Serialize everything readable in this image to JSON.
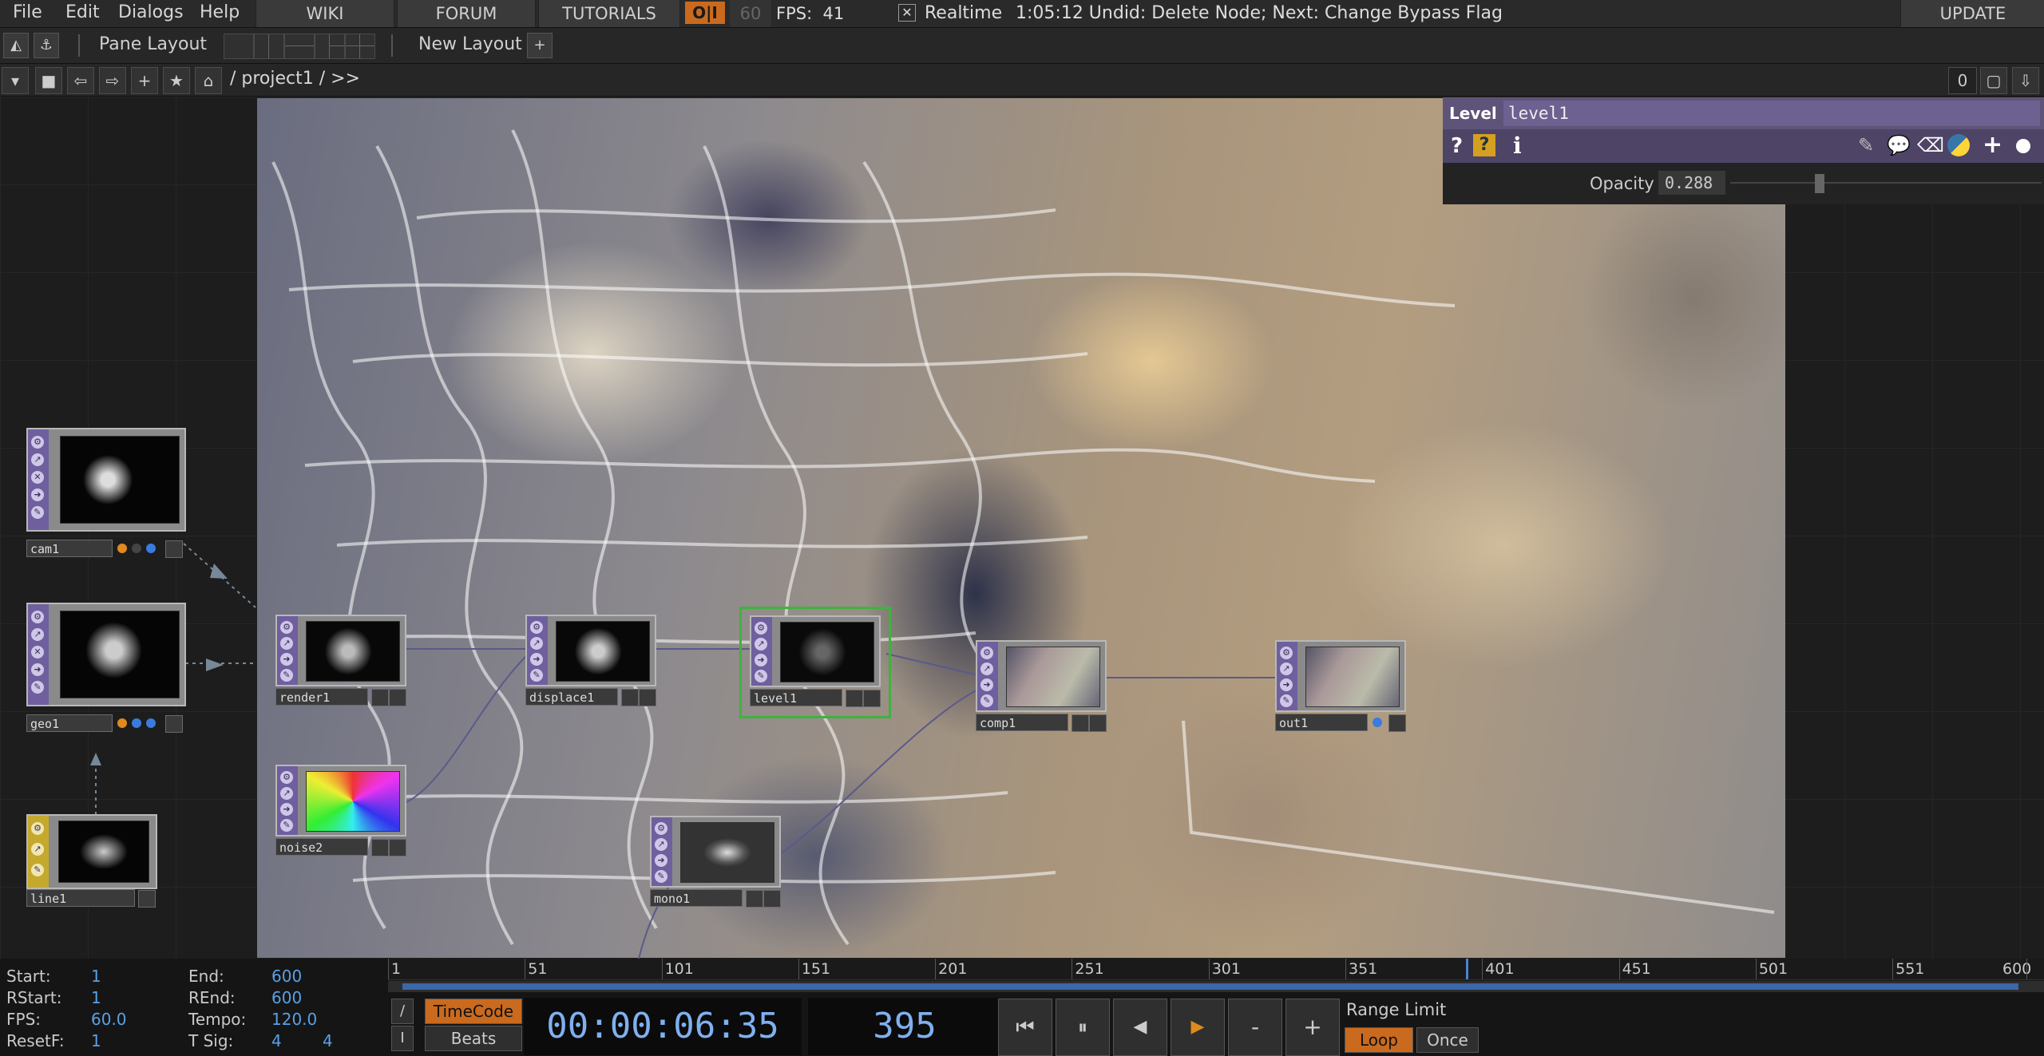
{
  "menu": {
    "file": "File",
    "edit": "Edit",
    "dialogs": "Dialogs",
    "help": "Help",
    "wiki": "WIKI",
    "forum": "FORUM",
    "tutorials": "TUTORIALS",
    "oi": "O|I",
    "fps_cap": "60",
    "fps_label": "FPS:",
    "fps_value": "41",
    "realtime_check": "✕",
    "realtime": "Realtime",
    "status": "1:05:12 Undid: Delete Node; Next: Change Bypass Flag",
    "update": "UPDATE"
  },
  "panebar": {
    "pane_layout": "Pane Layout",
    "new_layout": "New Layout",
    "add": "+"
  },
  "pathbar": {
    "path": "/ project1 / >>",
    "counter": "0"
  },
  "param": {
    "op_type": "Level",
    "op_name": "level1",
    "help_q": "?",
    "help_py": "?",
    "info": "i",
    "opacity_label": "Opacity",
    "opacity_value": "0.288",
    "opacity_fraction": 0.288
  },
  "nodes": [
    {
      "id": "cam1",
      "label": "cam1"
    },
    {
      "id": "geo1",
      "label": "geo1"
    },
    {
      "id": "line1",
      "label": "line1"
    },
    {
      "id": "render1",
      "label": "render1"
    },
    {
      "id": "displace1",
      "label": "displace1"
    },
    {
      "id": "level1",
      "label": "level1"
    },
    {
      "id": "comp1",
      "label": "comp1"
    },
    {
      "id": "out1",
      "label": "out1"
    },
    {
      "id": "noise2",
      "label": "noise2"
    },
    {
      "id": "mono1",
      "label": "mono1"
    }
  ],
  "timeline": {
    "start_key": "Start:",
    "start": "1",
    "rstart_key": "RStart:",
    "rstart": "1",
    "fps_key": "FPS:",
    "fps": "60.0",
    "resetf_key": "ResetF:",
    "resetf": "1",
    "end_key": "End:",
    "end": "600",
    "rend_key": "REnd:",
    "rend": "600",
    "tempo_key": "Tempo:",
    "tempo": "120.0",
    "tsig_key": "T Sig:",
    "tsig_a": "4",
    "tsig_b": "4",
    "ticks": [
      "1",
      "51",
      "101",
      "151",
      "201",
      "251",
      "301",
      "351",
      "401",
      "451",
      "501",
      "551",
      "600"
    ],
    "timecode_btn": "TimeCode",
    "beats_btn": "Beats",
    "timecode": "00:00:06:35",
    "frame": "395",
    "slash": "/",
    "bar": "I",
    "minus": "-",
    "plus": "+",
    "range_limit": "Range Limit",
    "loop": "Loop",
    "once": "Once",
    "playhead_frame": 395
  }
}
